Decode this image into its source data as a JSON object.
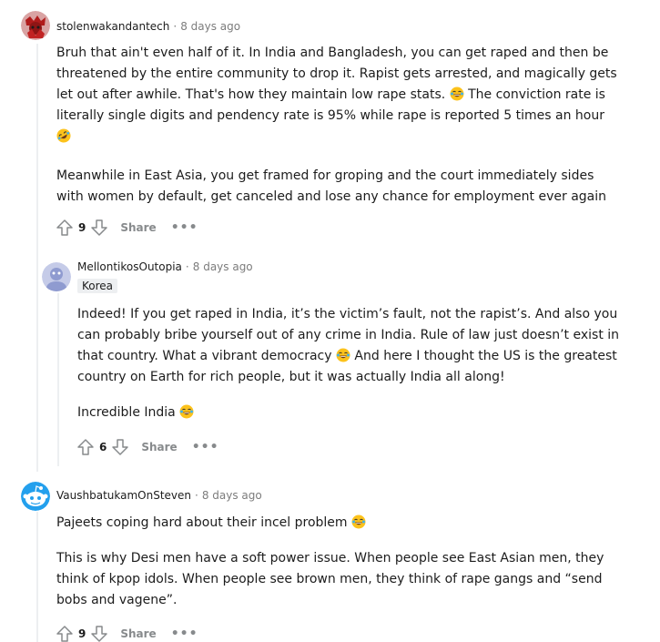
{
  "comments": [
    {
      "username": "stolenwakandantech",
      "time": "8 days ago",
      "paragraphs": [
        [
          "Bruh that ain't even half of it. In India and Bangladesh, you can get raped and then be",
          "threatened by the entire community to drop it. Rapist gets arrested, and magically gets",
          "let out after awhile. That's how they maintain low rape stats. ",
          " The conviction rate is",
          "literally single digits and pendency rate is 95% while rape is reported 5 times an hour"
        ],
        [
          "Meanwhile in East Asia, you get framed for groping and the court immediately sides",
          "with women by default, get canceled and lose any chance for employment ever again"
        ]
      ],
      "votes": "9",
      "share_label": "Share",
      "more_label": "•••"
    },
    {
      "username": "MellontikosOutopia",
      "time": "8 days ago",
      "flair": "Korea",
      "paragraphs": [
        [
          "Indeed! If you get raped in India, it’s the victim’s fault, not the rapist’s. And also you",
          "can probably bribe yourself out of any crime in India. Rule of law just doesn’t exist in",
          "that country. What a vibrant democracy ",
          " And here I thought the US is the greatest",
          "country on Earth for rich people, but it was actually India all along!"
        ],
        [
          "Incredible India "
        ]
      ],
      "votes": "6",
      "share_label": "Share",
      "more_label": "•••"
    },
    {
      "username": "VaushbatukamOnSteven",
      "time": "8 days ago",
      "paragraphs": [
        [
          "Pajeets coping hard about their incel problem "
        ],
        [
          "This is why Desi men have a soft power issue. When people see East Asian men, they",
          "think of kpop idols. When people see brown men, they think of rape gangs and “send",
          "bobs and vagene”."
        ]
      ],
      "votes": "9",
      "share_label": "Share",
      "more_label": "•••"
    }
  ],
  "icons": {
    "upvote": "upvote-arrow-icon",
    "downvote": "downvote-arrow-icon",
    "laugh": "tears-of-joy-emoji-icon",
    "rofl": "rolling-on-floor-laughing-emoji-icon"
  },
  "colors": {
    "meta_text": "#7c7c7c",
    "action_text": "#878a8c",
    "flair_bg": "#edeff1",
    "thread_line": "#edeff1"
  }
}
